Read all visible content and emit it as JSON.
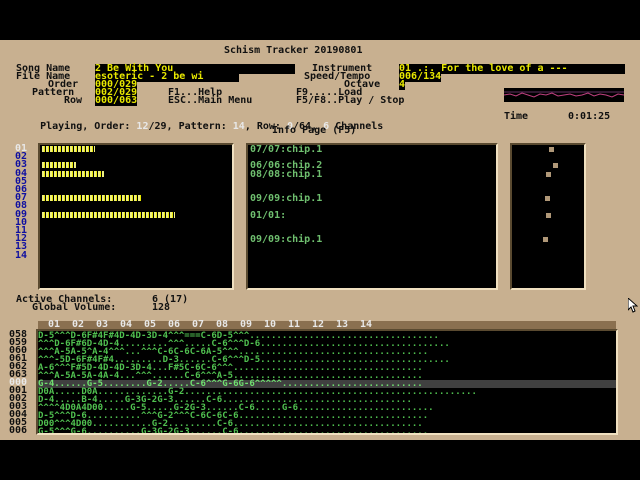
{
  "app": {
    "title": "Schism Tracker 20190801"
  },
  "header": {
    "song_name_label": "Song Name",
    "song_name": "2 Be With You",
    "file_name_label": "File Name",
    "file_name": "esoteric - 2 be wi",
    "order_label": "Order",
    "order": "000/029",
    "pattern_label": "Pattern",
    "pattern": "002/029",
    "row_label": "Row",
    "row": "000/063",
    "instrument_label": "Instrument",
    "instrument": "01 .:. For the love of a ---",
    "speed_label": "Speed/Tempo",
    "speed": "006/134",
    "octave_label": "Octave",
    "octave": "4",
    "help_f1": "F1...Help",
    "help_esc": "ESC..Main Menu",
    "help_f9": "F9.....Load",
    "help_f5": "F5/F8..Play / Stop"
  },
  "status": {
    "playing_label": "Playing, Order: ",
    "order_cur": "12",
    "order_tot": "/29",
    "pattern_label": ", Pattern: ",
    "pattern_cur": "14",
    "row_label": ", Row: ",
    "row_cur": "0",
    "row_tot": "/64",
    "channels_sep": ", ",
    "channels": "6",
    "channels_label": " Channels",
    "time_label": "Time",
    "time": "0:01:25"
  },
  "info_page": {
    "title": "Info Page (F5)"
  },
  "vu": {
    "channels": [
      {
        "num": "01",
        "level": 0.34,
        "active": true
      },
      {
        "num": "02",
        "level": 0,
        "active": false
      },
      {
        "num": "03",
        "level": 0.22,
        "active": false
      },
      {
        "num": "04",
        "level": 0.4,
        "active": false
      },
      {
        "num": "05",
        "level": 0,
        "active": false
      },
      {
        "num": "06",
        "level": 0,
        "active": false
      },
      {
        "num": "07",
        "level": 0.64,
        "active": false
      },
      {
        "num": "08",
        "level": 0,
        "active": false
      },
      {
        "num": "09",
        "level": 0.86,
        "active": false
      },
      {
        "num": "10",
        "level": 0,
        "active": false
      },
      {
        "num": "11",
        "level": 0,
        "active": false
      },
      {
        "num": "12",
        "level": 0,
        "active": false
      },
      {
        "num": "13",
        "level": 0,
        "active": false
      },
      {
        "num": "14",
        "level": 0,
        "active": false
      }
    ]
  },
  "samples": [
    {
      "text": "07/07:chip.1",
      "slot": 0
    },
    {
      "text": "06/06:chip.2",
      "slot": 2
    },
    {
      "text": "08/08:chip.1",
      "slot": 3
    },
    {
      "text": "09/09:chip.1",
      "slot": 6
    },
    {
      "text": "01/01:",
      "slot": 8
    },
    {
      "text": "09/09:chip.1",
      "slot": 11
    }
  ],
  "dots": [
    {
      "slot": 0,
      "pos": 0.55
    },
    {
      "slot": 2,
      "pos": 0.6
    },
    {
      "slot": 3,
      "pos": 0.5
    },
    {
      "slot": 6,
      "pos": 0.48
    },
    {
      "slot": 8,
      "pos": 0.5
    },
    {
      "slot": 11,
      "pos": 0.45
    }
  ],
  "summary": {
    "active_label": "Active Channels:",
    "active": "6 (17)",
    "volume_label": "Global Volume:",
    "volume": "128"
  },
  "pattern_view": {
    "channel_headers": [
      "01",
      "02",
      "03",
      "04",
      "05",
      "06",
      "07",
      "08",
      "09",
      "10",
      "11",
      "12",
      "13",
      "14"
    ],
    "rows": [
      {
        "num": "058",
        "text": "D-5^^^D-6F#4F#4D-4D-3D-4^^^===C-6D-5^^^..................................."
      },
      {
        "num": "059",
        "text": "^^^D-6F#6D-4D-4.........^^^.....C-6^^^D-6..................................."
      },
      {
        "num": "060",
        "text": "^^^A-5A-5^A-4^^^...^^^C-6C-6C-6A-5^^^..................................."
      },
      {
        "num": "061",
        "text": "^^^-5D-6F#4F#4.........D-3......C-6^^^D-5..................................."
      },
      {
        "num": "062",
        "text": "A-6^^^F#5D-4D-4D-3D-4...F#5C-6C-6^^^..................................."
      },
      {
        "num": "063",
        "text": "^^^A-5A-5A-4A-4...^^^......C-6^^^A-5..................................."
      },
      {
        "num": "000",
        "text": "G-4......G-5........G-2.....C-6^^^G-6G-6^^^^^..........................",
        "current": true
      },
      {
        "num": "001",
        "text": "D0A.....D0A.............G-2......................................................"
      },
      {
        "num": "002",
        "text": "D-4.....B-4.....G-3G-2G-3......C-6..................................."
      },
      {
        "num": "003",
        "text": "^^^^4D0A4D00.....G-5.....G-2G-3......C-6.....G-6........................."
      },
      {
        "num": "004",
        "text": "D-5^^^D-6..........^^^G-2^^^C-6C-6C-6..................................."
      },
      {
        "num": "005",
        "text": "D00^^^4D00...........G-2.........C-6..................................."
      },
      {
        "num": "006",
        "text": "G-5^^^G-6..........G-3G-2G-3......C-6..................................."
      }
    ]
  }
}
